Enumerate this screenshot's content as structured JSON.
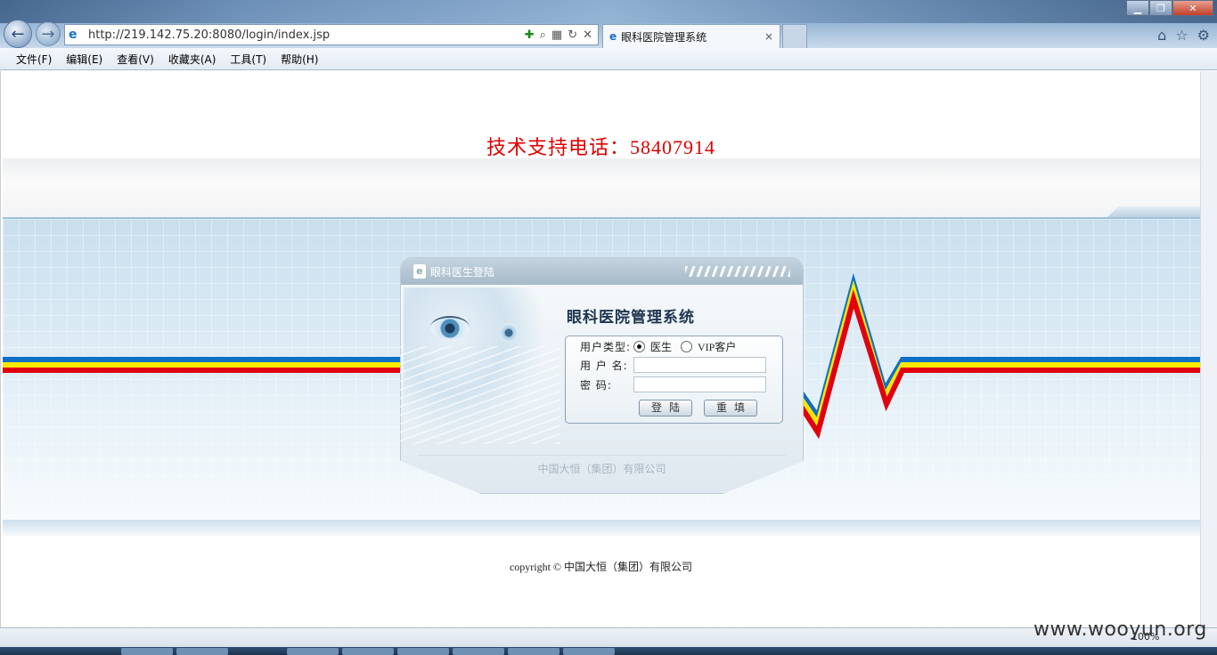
{
  "browser": {
    "url": "http://219.142.75.20:8080/login/index.jsp",
    "tab_title": "眼科医院管理系统",
    "tab_close": "×",
    "back_icon": "←",
    "forward_icon": "→",
    "ie_icon": "e"
  },
  "menu": [
    "文件(F)",
    "编辑(E)",
    "查看(V)",
    "收藏夹(A)",
    "工具(T)",
    "帮助(H)"
  ],
  "page": {
    "hotline": "技术支持电话：58407914",
    "copyright": "copyright © 中国大恒（集团）有限公司"
  },
  "login": {
    "header": "眼科医生登陆",
    "system_title": "眼科医院管理系统",
    "user_type_label": "用户类型:",
    "option_doctor": "医生",
    "option_vip": "VIP客户",
    "selected": "医生",
    "username_label": "用 户 名:",
    "username_value": "",
    "password_label": "密  码:",
    "password_value": "",
    "login_button": "登陆",
    "reset_button": "重填",
    "company": "中国大恒（集团）有限公司"
  },
  "status": {
    "zoom": "100%"
  },
  "watermark": "www.wooyun.org",
  "colors": {
    "hotline": "#e00000",
    "stripe_blue": "#1070c8",
    "stripe_yellow": "#f8e800",
    "stripe_red": "#e00010"
  }
}
